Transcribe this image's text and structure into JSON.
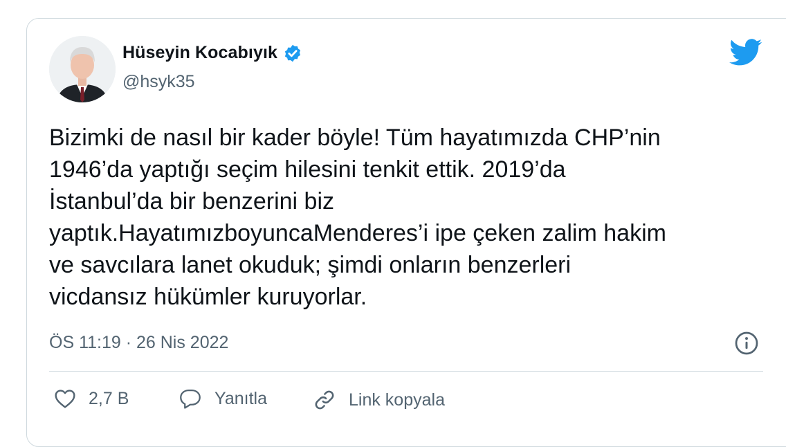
{
  "author": {
    "name": "Hüseyin Kocabıyık",
    "handle": "@hsyk35",
    "verified": true
  },
  "tweet": {
    "text": "Bizimki de nasıl bir kader böyle! Tüm hayatımızda CHP’nin\n1946’da yaptığı seçim hilesini tenkit ettik. 2019’da\nİstanbul’da bir benzerini biz\nyaptık.HayatımızboyuncaMenderes’i ipe çeken zalim hakim\nve savcılara lanet okuduk; şimdi onların benzerleri\nvicdansız hükümler kuruyorlar.",
    "timestamp": "ÖS 11:19 · 26 Nis 2022"
  },
  "actions": {
    "like_count": "2,7 B",
    "reply_label": "Yanıtla",
    "copy_label": "Link kopyala"
  },
  "icons": {
    "verified": "verified-badge-icon",
    "brand": "twitter-bird-icon",
    "info": "info-icon",
    "like": "heart-icon",
    "reply": "speech-bubble-icon",
    "copy": "link-icon"
  },
  "colors": {
    "accent": "#1d9bf0",
    "text": "#0f1419",
    "secondary": "#536471",
    "border": "#cfd9de"
  }
}
